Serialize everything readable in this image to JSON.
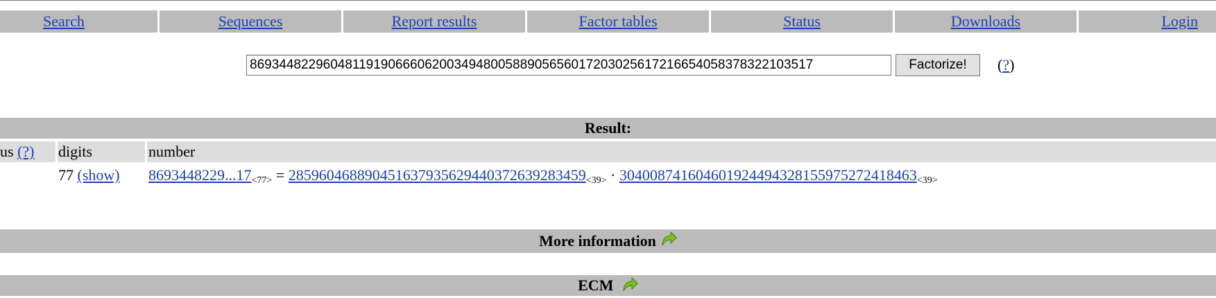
{
  "nav": {
    "items": [
      {
        "label": "Search"
      },
      {
        "label": "Sequences"
      },
      {
        "label": "Report results"
      },
      {
        "label": "Factor tables"
      },
      {
        "label": "Status"
      },
      {
        "label": "Downloads"
      },
      {
        "label": "Login"
      }
    ]
  },
  "form": {
    "number_value": "86934482296048119190666062003494800588905656017203025617216654058378322103517",
    "submit_label": "Factorize!",
    "help_open": "(",
    "help_link": "?",
    "help_close": ")"
  },
  "result": {
    "header": "Result:",
    "columns": {
      "status": "us",
      "status_help": "(?)",
      "digits": "digits",
      "number": "number"
    },
    "row": {
      "digits": "77",
      "show_link": "(show)",
      "number_short": "8693448229...17",
      "number_size": "<77>",
      "equals": "=",
      "factor1": "285960468890451637935629440372639283459",
      "factor1_size": "<39>",
      "dot": "·",
      "factor2": "304008741604601924494328155975272418463",
      "factor2_size": "<39>"
    }
  },
  "more_info": {
    "label": "More information",
    "icon": "green-arrow-icon"
  },
  "ecm": {
    "label": "ECM",
    "icon": "green-arrow-icon"
  },
  "colors": {
    "bar_gray": "#bbbbbb",
    "row_gray": "#dddddd",
    "link_blue": "#1a3fb5",
    "arrow_green": "#7cc21a"
  }
}
